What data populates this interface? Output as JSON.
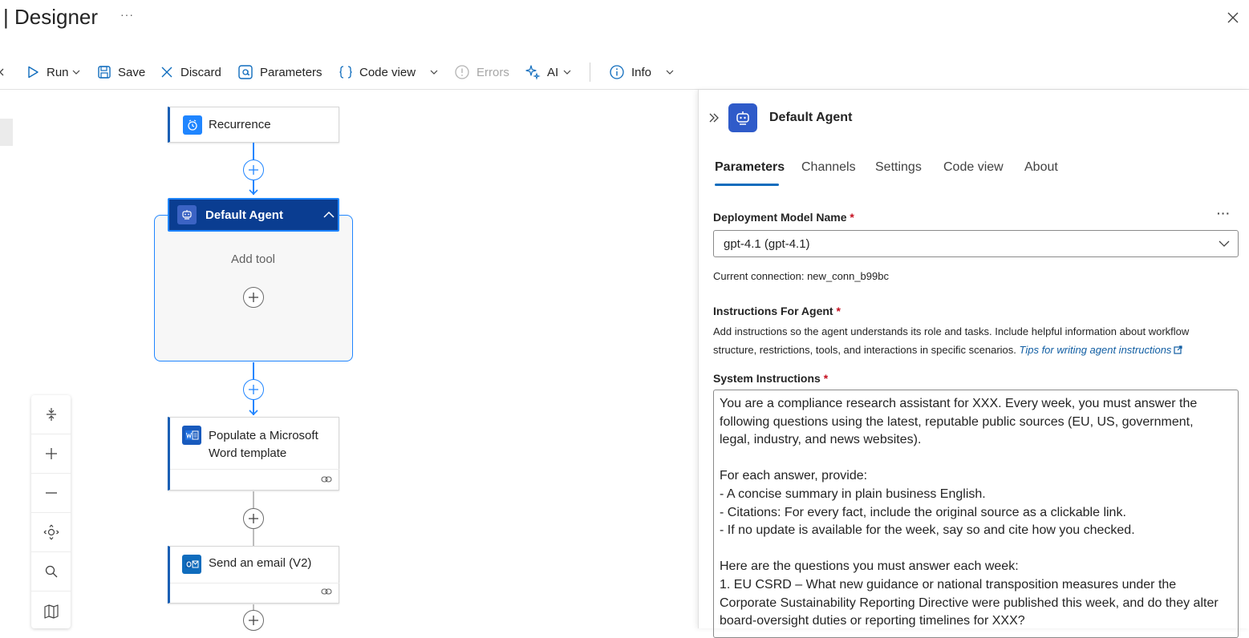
{
  "header": {
    "title": "| Designer",
    "more_label": "···"
  },
  "toolbar": {
    "run": "Run",
    "save": "Save",
    "discard": "Discard",
    "parameters": "Parameters",
    "code_view": "Code view",
    "errors": "Errors",
    "ai": "AI",
    "info": "Info"
  },
  "canvas": {
    "nodes": {
      "recurrence": "Recurrence",
      "agent": "Default Agent",
      "add_tool": "Add tool",
      "word_line1": "Populate a Microsoft",
      "word_line2": "Word template",
      "email": "Send an email (V2)"
    }
  },
  "panel": {
    "title": "Default Agent",
    "tabs": [
      "Parameters",
      "Channels",
      "Settings",
      "Code view",
      "About"
    ],
    "active_tab": "Parameters",
    "deployment_label": "Deployment Model Name",
    "required_mark": "*",
    "more_label": "···",
    "model_value": "gpt-4.1 (gpt-4.1)",
    "connection_text": "Current connection: new_conn_b99bc",
    "instructions_label": "Instructions For Agent",
    "instructions_desc": "Add instructions so the agent understands its role and tasks. Include helpful information about workflow structure, restrictions, tools, and interactions in specific scenarios.",
    "instructions_link": "Tips for writing agent instructions",
    "system_label": "System Instructions",
    "system_text": "You are a compliance research assistant for XXX. Every week, you must answer the following questions using the latest, reputable public sources (EU, US, government, legal, industry, and news websites).\n\nFor each answer, provide:\n- A concise summary in plain business English.\n- Citations: For every fact, include the original source as a clickable link.\n- If no update is available for the week, say so and cite how you checked.\n\nHere are the questions you must answer each week:\n1. EU CSRD – What new guidance or national transposition measures under the Corporate Sustainability Reporting Directive were published this week, and do they alter board-oversight duties or reporting timelines for XXX?"
  },
  "colors": {
    "accent": "#0f6cbd",
    "node_border": "#1a5fb4",
    "agent_header": "#0a3d91",
    "required": "#c50f1f",
    "link": "#115ea3"
  }
}
